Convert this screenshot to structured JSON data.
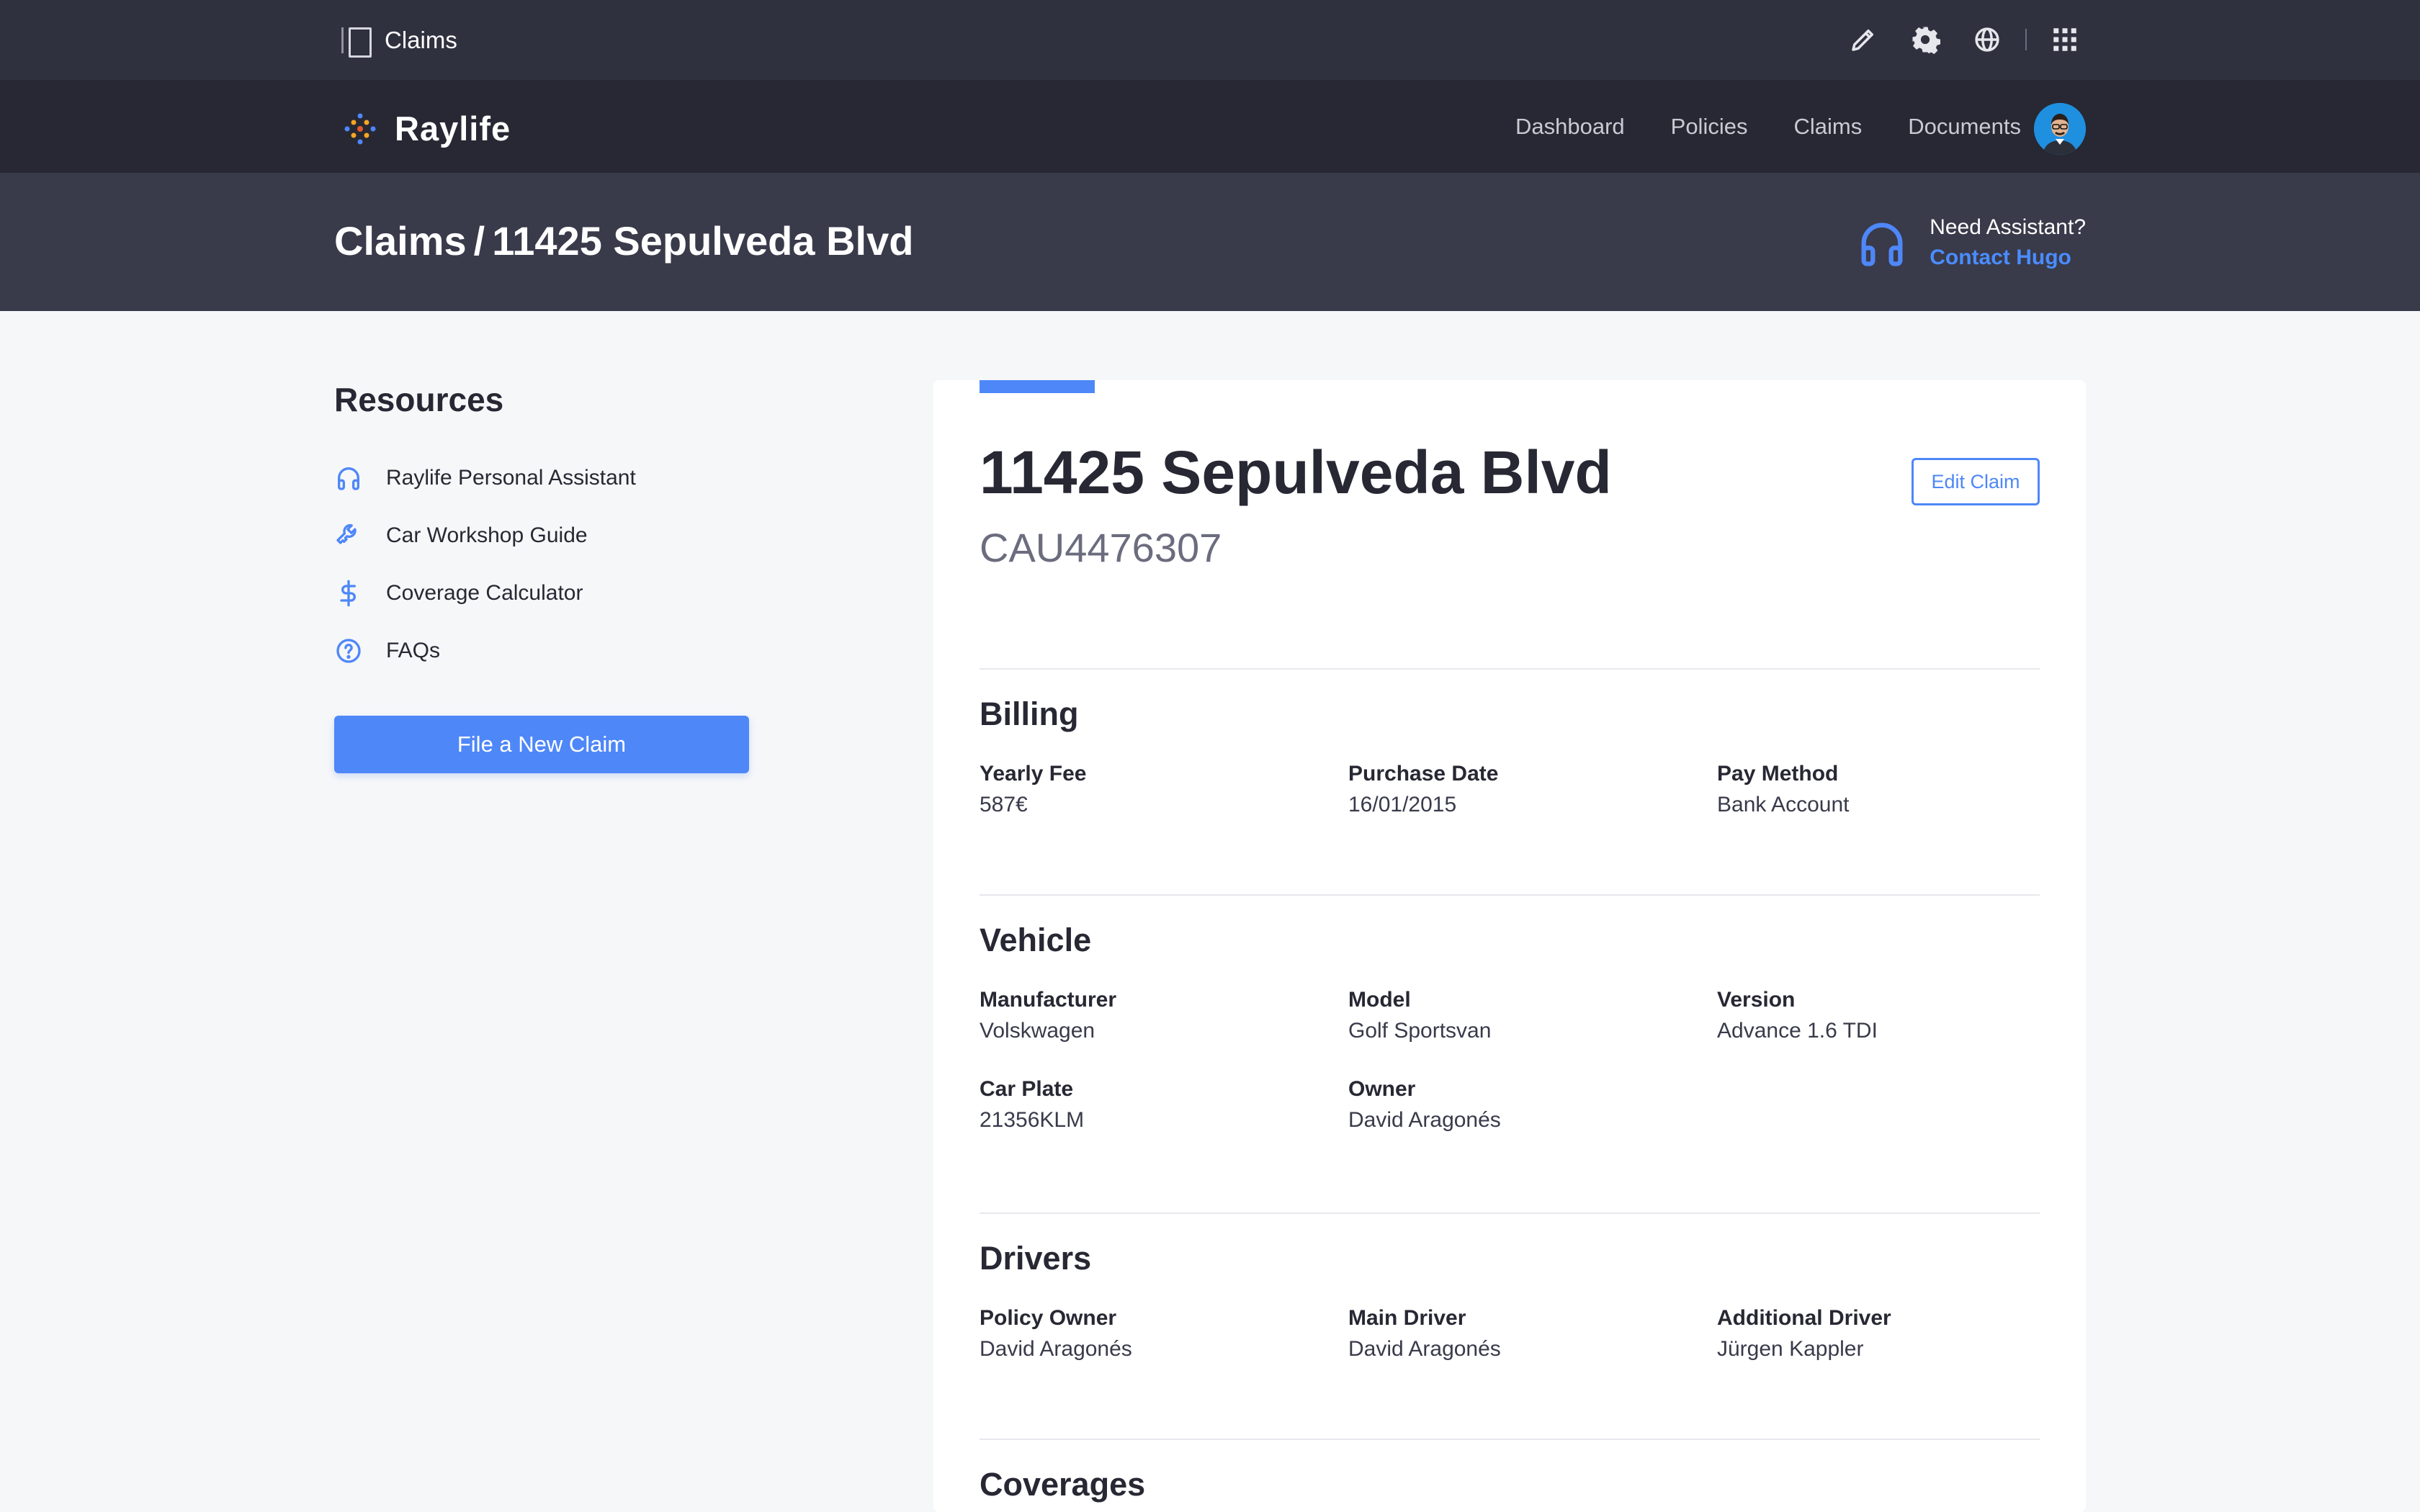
{
  "control_bar": {
    "title": "Claims",
    "icons": [
      "sidebar-toggle-icon",
      "pencil-icon",
      "gear-icon",
      "globe-icon",
      "apps-grid-icon"
    ]
  },
  "navbar": {
    "brand": "Raylife",
    "links": [
      "Dashboard",
      "Policies",
      "Claims",
      "Documents"
    ]
  },
  "header": {
    "breadcrumb_root": "Claims",
    "breadcrumb_separator": "/",
    "breadcrumb_current": "11425 Sepulveda Blvd",
    "assist_question": "Need Assistant?",
    "assist_link": "Contact Hugo"
  },
  "resources": {
    "title": "Resources",
    "items": [
      {
        "label": "Raylife Personal Assistant",
        "icon": "headset-icon"
      },
      {
        "label": "Car Workshop Guide",
        "icon": "wrench-icon"
      },
      {
        "label": "Coverage Calculator",
        "icon": "dollar-icon"
      },
      {
        "label": "FAQs",
        "icon": "question-circle-icon"
      }
    ],
    "file_claim_label": "File a New Claim"
  },
  "claim": {
    "title": "11425 Sepulveda Blvd",
    "code": "CAU4476307",
    "edit_label": "Edit Claim",
    "billing": {
      "title": "Billing",
      "fields": [
        {
          "label": "Yearly Fee",
          "value": "587€"
        },
        {
          "label": "Purchase Date",
          "value": "16/01/2015"
        },
        {
          "label": "Pay Method",
          "value": "Bank Account"
        }
      ]
    },
    "vehicle": {
      "title": "Vehicle",
      "fields": [
        {
          "label": "Manufacturer",
          "value": "Volskwagen"
        },
        {
          "label": "Model",
          "value": "Golf Sportsvan"
        },
        {
          "label": "Version",
          "value": "Advance 1.6 TDI"
        },
        {
          "label": "Car Plate",
          "value": "21356KLM"
        },
        {
          "label": "Owner",
          "value": "David Aragonés"
        }
      ]
    },
    "drivers": {
      "title": "Drivers",
      "fields": [
        {
          "label": "Policy Owner",
          "value": "David Aragonés"
        },
        {
          "label": "Main Driver",
          "value": "David Aragonés"
        },
        {
          "label": "Additional Driver",
          "value": "Jürgen Kappler"
        }
      ]
    },
    "coverages": {
      "title": "Coverages"
    }
  },
  "colors": {
    "accent": "#4e87f8",
    "control_bar": "#30313f",
    "navbar": "#272833",
    "header_band": "#393a4a",
    "page_bg": "#f6f7f9"
  }
}
